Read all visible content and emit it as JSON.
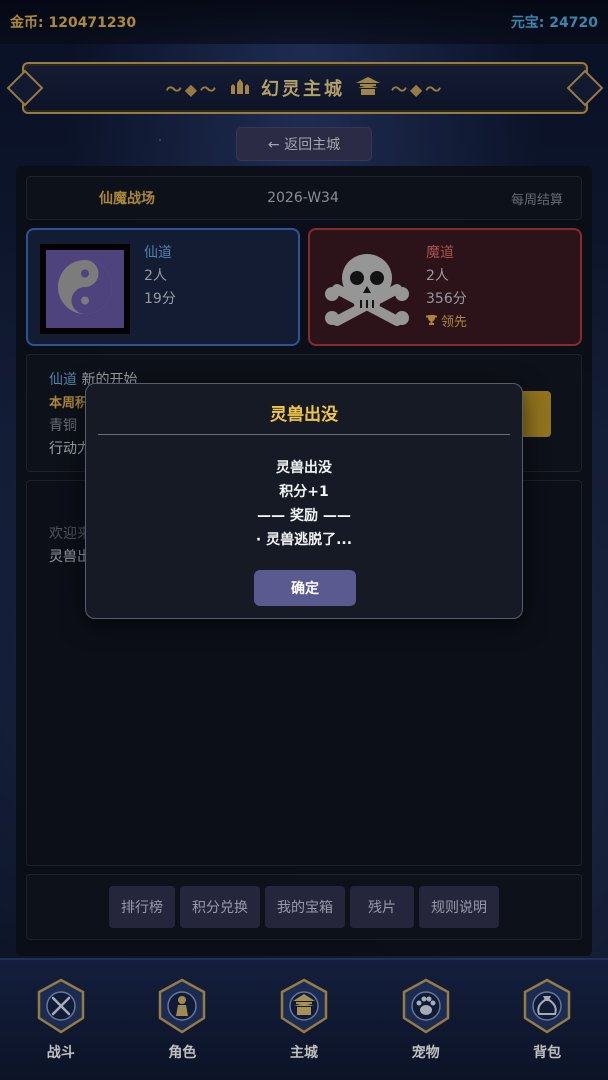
{
  "topbar": {
    "gold": "金币: 120471230",
    "yuanbao": "元宝: 24720"
  },
  "banner": {
    "title": "幻灵主城"
  },
  "back_button": "← 返回主城",
  "arena": {
    "name": "仙魔战场",
    "week": "2026-W34",
    "settle": "每周结算"
  },
  "factions": {
    "xian": {
      "name": "仙道",
      "members": "2人",
      "score": "19分"
    },
    "mo": {
      "name": "魔道",
      "members": "2人",
      "score": "356分",
      "lead": "领先"
    }
  },
  "status": {
    "faction": "仙道",
    "faction_suffix": "新的开始",
    "week_label": "本周积",
    "rank": "青铜",
    "action": "行动力"
  },
  "log": {
    "welcome": "欢迎来",
    "line": "灵兽出"
  },
  "actions": [
    "排行榜",
    "积分兑换",
    "我的宝箱",
    "残片",
    "规则说明"
  ],
  "nav": [
    {
      "label": "战斗",
      "icon": "crossed-swords-icon"
    },
    {
      "label": "角色",
      "icon": "character-icon"
    },
    {
      "label": "主城",
      "icon": "city-icon"
    },
    {
      "label": "宠物",
      "icon": "paw-icon"
    },
    {
      "label": "背包",
      "icon": "bag-icon"
    }
  ],
  "modal": {
    "title": "灵兽出没",
    "line1": "灵兽出没",
    "line2": "积分+1",
    "line3": "—— 奖励 ——",
    "line4": "· 灵兽逃脱了...",
    "ok": "确定"
  },
  "colors": {
    "gold": "#e6b94a",
    "yuanbao": "#4fb0e8",
    "xian": "#3c6fc8",
    "mo": "#b83a3a",
    "modal_title": "#f0c64a"
  }
}
